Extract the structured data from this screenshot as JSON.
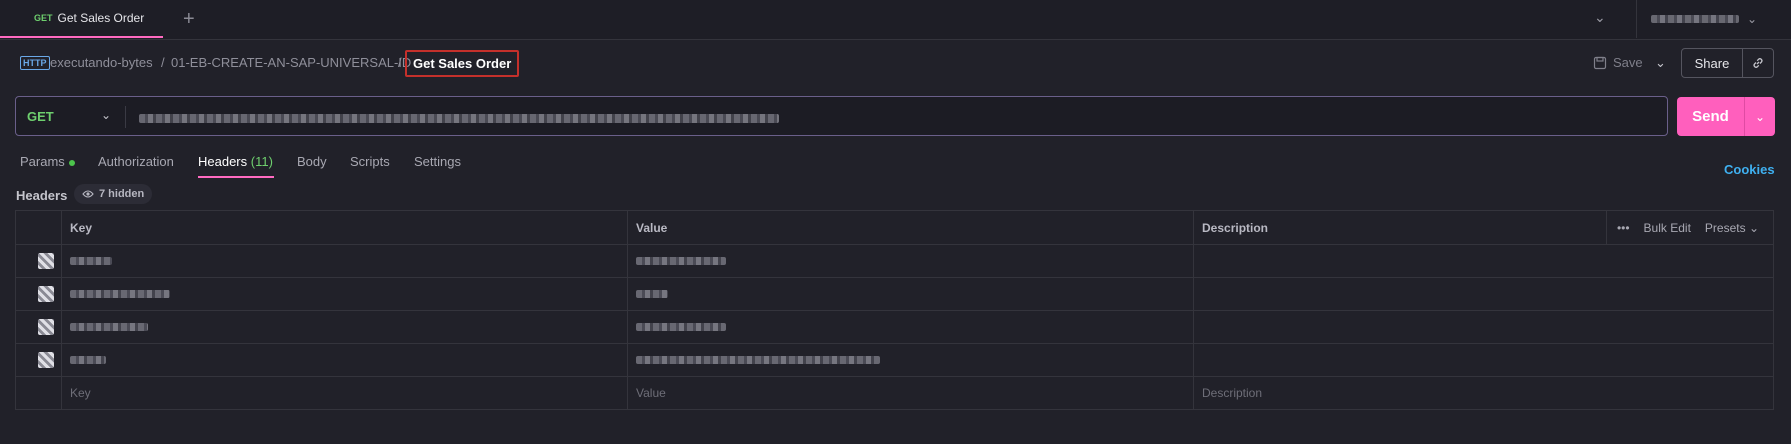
{
  "tab": {
    "method": "GET",
    "title": "Get Sales Order"
  },
  "breadcrumb": {
    "icon_text": "HTTP",
    "workspace": "executando-bytes",
    "collection": "01-EB-CREATE-AN-SAP-UNIVERSAL-ID",
    "separator": "/",
    "current": "Get Sales Order"
  },
  "actions": {
    "save": "Save",
    "share": "Share"
  },
  "request": {
    "method": "GET",
    "send": "Send"
  },
  "request_tabs": {
    "params": "Params",
    "authorization": "Authorization",
    "headers": "Headers",
    "headers_count": "(11)",
    "body": "Body",
    "scripts": "Scripts",
    "settings": "Settings",
    "cookies": "Cookies"
  },
  "headers_section": {
    "label": "Headers",
    "hidden": "7 hidden"
  },
  "table": {
    "columns": {
      "key": "Key",
      "value": "Value",
      "description": "Description"
    },
    "bulk_edit": "Bulk Edit",
    "presets": "Presets",
    "placeholder": {
      "key": "Key",
      "value": "Value",
      "description": "Description"
    }
  },
  "colors": {
    "accent": "#ff6ac1",
    "send": "#ff5fbd",
    "get": "#6ecf6e",
    "link": "#3fb0f0"
  }
}
